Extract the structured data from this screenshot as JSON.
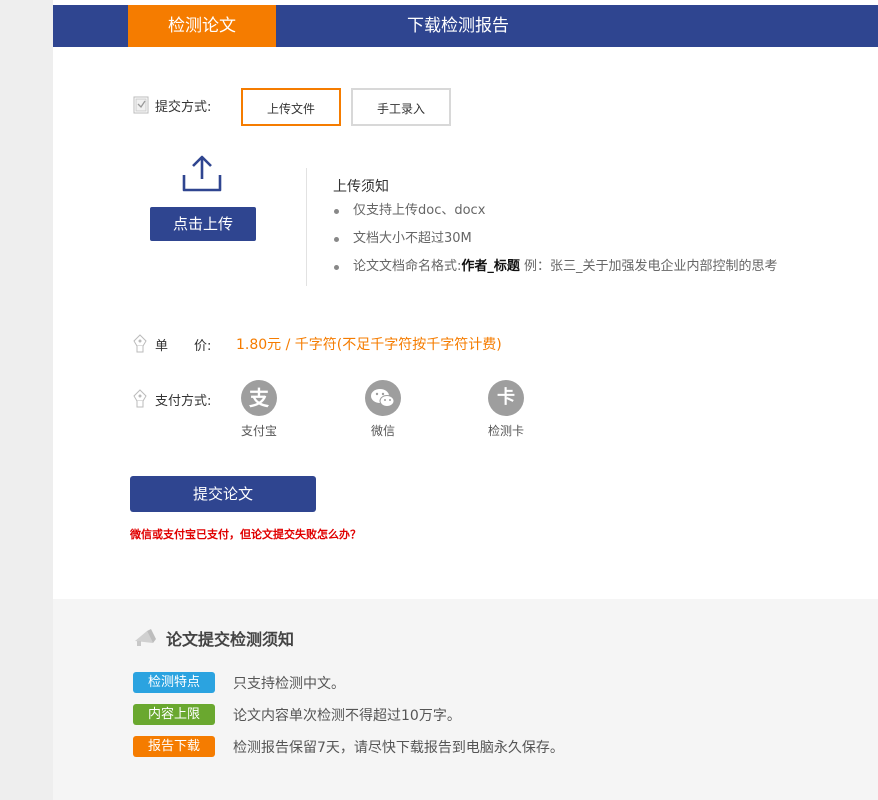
{
  "tabs": {
    "active": "检测论文",
    "download": "下载检测报告"
  },
  "submit_method": {
    "label": "提交方式:",
    "options": [
      "上传文件",
      "手工录入"
    ],
    "selected": "上传文件"
  },
  "upload": {
    "button": "点击上传"
  },
  "notice": {
    "title": "上传须知",
    "item1": "仅支持上传doc、docx",
    "item2": "文档大小不超过30M",
    "item3_prefix": "论文文档命名格式:",
    "item3_bold": "作者_标题",
    "item3_example": "例：张三_关于加强发电企业内部控制的思考"
  },
  "price": {
    "label": "单　　价:",
    "value": "1.80元 / 千字符(不足千字符按千字符计费)"
  },
  "payment": {
    "label": "支付方式:",
    "alipay": "支付宝",
    "wechat": "微信",
    "card": "检测卡",
    "card_glyph": "卡",
    "alipay_glyph": "支"
  },
  "submit": {
    "button": "提交论文",
    "fail_link": "微信或支付宝已支付，但论文提交失败怎么办？"
  },
  "section": {
    "title": "论文提交检测须知",
    "tags": [
      {
        "label": "检测特点",
        "text": "只支持检测中文。",
        "color": "#2ba3e0"
      },
      {
        "label": "内容上限",
        "text": "论文内容单次检测不得超过10万字。",
        "color": "#6aa82f"
      },
      {
        "label": "报告下载",
        "text": "检测报告保留7天，请尽快下载报告到电脑永久保存。",
        "color": "#f57c00"
      }
    ]
  },
  "colors": {
    "brand": "#2f4590",
    "accent": "#f57c00",
    "alert": "#e00000"
  },
  "icons": [
    "document-check-icon",
    "upload-icon",
    "price-tag-icon",
    "payment-tag-icon",
    "alipay-icon",
    "wechat-icon",
    "card-icon",
    "megaphone-icon"
  ]
}
